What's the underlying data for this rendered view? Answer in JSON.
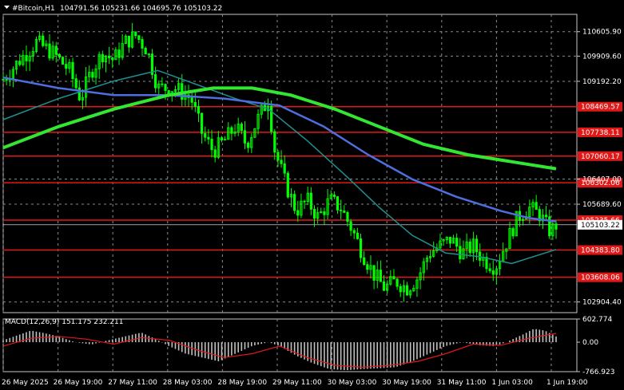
{
  "header": {
    "symbol_label": "#Bitcoin,H1",
    "ohlc": "104791.56 105231.66 104695.76 105103.22"
  },
  "colors": {
    "background": "#000000",
    "candle": "#00ff00",
    "ma_fast": "#1f8f8f",
    "ma_mid": "#4f6fe0",
    "ma_slow": "#32e632",
    "level_line": "#e01818",
    "macd_hist": "#c0c0c0",
    "macd_signal": "#e01818",
    "grid": "#8a8a8a"
  },
  "chart_data": [
    {
      "type": "candlestick",
      "title": "#Bitcoin,H1",
      "ylim": [
        102600,
        111100
      ],
      "y_ticks": [
        "110605.90",
        "109909.60",
        "109192.20",
        "106407.00",
        "105689.60",
        "102904.40"
      ],
      "x_ticks": [
        "26 May 2025",
        "26 May 19:00",
        "27 May 11:00",
        "28 May 03:00",
        "28 May 19:00",
        "29 May 11:00",
        "30 May 03:00",
        "30 May 19:00",
        "31 May 11:00",
        "1 Jun 03:00",
        "1 Jun 19:00"
      ],
      "current_price": "105103.22",
      "current_price_value": 105103.22,
      "horizontal_levels": [
        {
          "value": 108469.57,
          "label": "108469.57"
        },
        {
          "value": 107738.11,
          "label": "107738.11"
        },
        {
          "value": 107060.17,
          "label": "107060.17"
        },
        {
          "value": 106302.06,
          "label": "106302.06"
        },
        {
          "value": 105235.66,
          "label": "105235.66"
        },
        {
          "value": 104383.8,
          "label": "104383.80"
        },
        {
          "value": 103608.06,
          "label": "103608.06"
        }
      ],
      "close_path": [
        [
          0,
          109250
        ],
        [
          0.03,
          109800
        ],
        [
          0.06,
          110300
        ],
        [
          0.09,
          110000
        ],
        [
          0.12,
          109500
        ],
        [
          0.14,
          108700
        ],
        [
          0.16,
          109500
        ],
        [
          0.18,
          110000
        ],
        [
          0.2,
          109800
        ],
        [
          0.22,
          110300
        ],
        [
          0.24,
          110500
        ],
        [
          0.26,
          110100
        ],
        [
          0.28,
          109000
        ],
        [
          0.31,
          109000
        ],
        [
          0.34,
          108700
        ],
        [
          0.36,
          107700
        ],
        [
          0.38,
          107200
        ],
        [
          0.4,
          107500
        ],
        [
          0.42,
          107900
        ],
        [
          0.44,
          107400
        ],
        [
          0.46,
          108100
        ],
        [
          0.48,
          108700
        ],
        [
          0.49,
          107300
        ],
        [
          0.51,
          106300
        ],
        [
          0.53,
          105500
        ],
        [
          0.55,
          105800
        ],
        [
          0.57,
          105300
        ],
        [
          0.59,
          105800
        ],
        [
          0.61,
          105600
        ],
        [
          0.63,
          105000
        ],
        [
          0.65,
          104300
        ],
        [
          0.67,
          103700
        ],
        [
          0.69,
          103300
        ],
        [
          0.71,
          103500
        ],
        [
          0.73,
          103300
        ],
        [
          0.75,
          103600
        ],
        [
          0.77,
          104300
        ],
        [
          0.79,
          104500
        ],
        [
          0.81,
          104700
        ],
        [
          0.83,
          104300
        ],
        [
          0.85,
          104500
        ],
        [
          0.87,
          104100
        ],
        [
          0.89,
          103900
        ],
        [
          0.91,
          104600
        ],
        [
          0.93,
          105300
        ],
        [
          0.95,
          105600
        ],
        [
          0.97,
          105400
        ],
        [
          0.99,
          104900
        ],
        [
          1.0,
          105103
        ]
      ],
      "series": [
        {
          "name": "ma_fast",
          "points": [
            [
              0,
              108100
            ],
            [
              0.1,
              108700
            ],
            [
              0.2,
              109200
            ],
            [
              0.28,
              109500
            ],
            [
              0.35,
              109100
            ],
            [
              0.42,
              108700
            ],
            [
              0.48,
              108400
            ],
            [
              0.55,
              107500
            ],
            [
              0.62,
              106500
            ],
            [
              0.68,
              105600
            ],
            [
              0.74,
              104800
            ],
            [
              0.8,
              104300
            ],
            [
              0.86,
              104200
            ],
            [
              0.92,
              104000
            ],
            [
              1.0,
              104400
            ]
          ]
        },
        {
          "name": "ma_mid",
          "points": [
            [
              0,
              109300
            ],
            [
              0.1,
              109000
            ],
            [
              0.2,
              108800
            ],
            [
              0.3,
              108800
            ],
            [
              0.4,
              108700
            ],
            [
              0.5,
              108500
            ],
            [
              0.58,
              107900
            ],
            [
              0.66,
              107100
            ],
            [
              0.74,
              106400
            ],
            [
              0.82,
              105900
            ],
            [
              0.9,
              105500
            ],
            [
              0.95,
              105300
            ],
            [
              1.0,
              105200
            ]
          ]
        },
        {
          "name": "ma_slow",
          "points": [
            [
              0,
              107300
            ],
            [
              0.1,
              107900
            ],
            [
              0.2,
              108400
            ],
            [
              0.3,
              108800
            ],
            [
              0.38,
              109000
            ],
            [
              0.45,
              109000
            ],
            [
              0.52,
              108800
            ],
            [
              0.6,
              108400
            ],
            [
              0.68,
              107900
            ],
            [
              0.76,
              107400
            ],
            [
              0.84,
              107100
            ],
            [
              0.92,
              106900
            ],
            [
              1.0,
              106700
            ]
          ]
        }
      ]
    },
    {
      "type": "macd",
      "title": "MACD(12,26,9) 151.175 232.211",
      "y_ticks": [
        "602.774",
        "0.00",
        "-766.923"
      ],
      "ylim": [
        -766.923,
        602.774
      ],
      "histogram": [
        [
          0,
          50
        ],
        [
          0.03,
          200
        ],
        [
          0.05,
          300
        ],
        [
          0.07,
          250
        ],
        [
          0.1,
          150
        ],
        [
          0.13,
          0
        ],
        [
          0.16,
          -60
        ],
        [
          0.19,
          50
        ],
        [
          0.22,
          150
        ],
        [
          0.25,
          250
        ],
        [
          0.27,
          120
        ],
        [
          0.3,
          -100
        ],
        [
          0.33,
          -300
        ],
        [
          0.36,
          -400
        ],
        [
          0.39,
          -500
        ],
        [
          0.42,
          -300
        ],
        [
          0.45,
          -100
        ],
        [
          0.48,
          0
        ],
        [
          0.5,
          -100
        ],
        [
          0.53,
          -350
        ],
        [
          0.56,
          -550
        ],
        [
          0.59,
          -700
        ],
        [
          0.62,
          -730
        ],
        [
          0.65,
          -700
        ],
        [
          0.68,
          -680
        ],
        [
          0.71,
          -650
        ],
        [
          0.74,
          -500
        ],
        [
          0.77,
          -300
        ],
        [
          0.8,
          -100
        ],
        [
          0.83,
          0
        ],
        [
          0.86,
          -80
        ],
        [
          0.89,
          -100
        ],
        [
          0.91,
          0
        ],
        [
          0.94,
          200
        ],
        [
          0.96,
          350
        ],
        [
          0.98,
          300
        ],
        [
          1.0,
          150
        ]
      ],
      "signal": [
        [
          0,
          -100
        ],
        [
          0.05,
          100
        ],
        [
          0.1,
          150
        ],
        [
          0.15,
          80
        ],
        [
          0.2,
          -50
        ],
        [
          0.25,
          120
        ],
        [
          0.3,
          50
        ],
        [
          0.35,
          -200
        ],
        [
          0.4,
          -400
        ],
        [
          0.45,
          -300
        ],
        [
          0.5,
          -100
        ],
        [
          0.55,
          -400
        ],
        [
          0.6,
          -600
        ],
        [
          0.65,
          -650
        ],
        [
          0.7,
          -600
        ],
        [
          0.75,
          -500
        ],
        [
          0.8,
          -300
        ],
        [
          0.85,
          -50
        ],
        [
          0.9,
          -80
        ],
        [
          0.95,
          100
        ],
        [
          1.0,
          230
        ]
      ]
    }
  ]
}
